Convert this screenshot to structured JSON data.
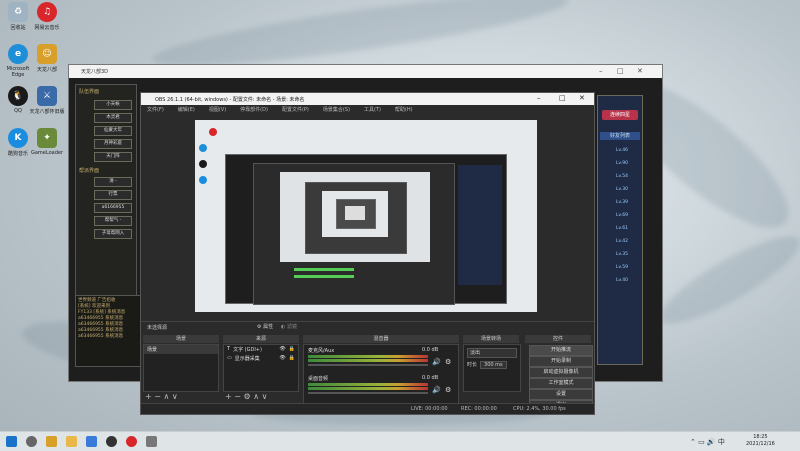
{
  "desktop": {
    "icons": [
      {
        "label": "回收站",
        "icon": "recycle-bin-icon",
        "color": "#9fb3c2"
      },
      {
        "label": "网易云音乐",
        "icon": "netease-music-icon",
        "color": "#d9262b"
      },
      {
        "label": "Microsoft Edge",
        "icon": "edge-icon",
        "color": "#1d8fd8"
      },
      {
        "label": "天龙八部",
        "icon": "game-icon",
        "color": "#d8a02a"
      },
      {
        "label": "QQ",
        "icon": "qq-icon",
        "color": "#1a1a1a"
      },
      {
        "label": "天龙八部怀旧版",
        "icon": "game2-icon",
        "color": "#3a6aa8"
      },
      {
        "label": "酷狗音乐",
        "icon": "kugou-icon",
        "color": "#1a8de0"
      },
      {
        "label": "GameLoader",
        "icon": "loader-icon",
        "color": "#6a8a3a"
      }
    ]
  },
  "game_window": {
    "title": "天龙八部3D",
    "menu_title": "队伍界面",
    "buttons": [
      "小天帐",
      "木灵君",
      "仙蒙大年",
      "月神彩庭",
      "天门阵"
    ],
    "section2": "帮派界面",
    "buttons2": [
      "清 -",
      "行票",
      "a6166955",
      "帮帮气 -",
      "子母帮网入"
    ],
    "right_banner": "连续四星",
    "right_header": "好友列表",
    "right_items": [
      "Lv.46",
      "Lv.90",
      "Lv.54",
      "Lv.30",
      "Lv.39",
      "Lv.69",
      "Lv.61",
      "Lv.42",
      "Lv.35",
      "Lv.59",
      "Lv.40"
    ],
    "chat_lines": [
      "世界频道 广告招收",
      "[系统] 欢迎来到",
      "FY133 [系统] 系统消息",
      "a63466955 系统消息",
      "a63466955 系统消息",
      "a63466955 系统消息",
      "a63466955 系统消息"
    ]
  },
  "obs": {
    "title": "OBS 26.1.1 (64-bit, windows) - 配置文件: 未命名 - 场景: 未命名",
    "menu": [
      "文件(F)",
      "编辑(E)",
      "视图(V)",
      "停靠部件(D)",
      "配置文件(P)",
      "场景集合(S)",
      "工具(T)",
      "帮助(H)"
    ],
    "no_source": "未选择源",
    "props_label": "属性",
    "filters_label": "滤镜",
    "docks": {
      "scenes": "场景",
      "sources": "来源",
      "mixer": "混音器",
      "transitions": "场景转场",
      "controls": "控件"
    },
    "scene_item": "场景",
    "source_items": [
      "文字 (GDI+)",
      "显示器采集"
    ],
    "mixer_tracks": [
      {
        "name": "麦克风/Aux",
        "db": "0.0 dB"
      },
      {
        "name": "桌面音频",
        "db": "0.0 dB"
      }
    ],
    "transition": {
      "type": "淡出",
      "duration_label": "时长",
      "duration": "300 ms"
    },
    "controls": [
      "开始推流",
      "开始录制",
      "启动虚拟摄像机",
      "工作室模式",
      "设置",
      "退出"
    ],
    "status": {
      "live": "LIVE: 00:00:00",
      "rec": "REC: 00:00:00",
      "cpu": "CPU: 2.4%, 30.00 fps"
    }
  },
  "taskbar": {
    "time": "18:25",
    "date": "2021/12/16",
    "icons": [
      "windows-icon",
      "search-icon",
      "game-icon",
      "folder-icon",
      "store-icon",
      "obs-icon",
      "music-icon",
      "settings-icon"
    ],
    "colors": [
      "#1a73c8",
      "#666",
      "#d8a02a",
      "#e8b84a",
      "#3a7ad8",
      "#333",
      "#d9262b",
      "#777"
    ]
  }
}
